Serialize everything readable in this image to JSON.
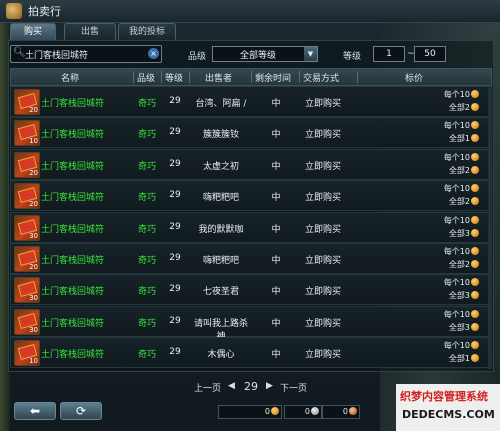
{
  "window": {
    "title": "拍卖行"
  },
  "tabs": [
    {
      "label": "购买",
      "active": true
    },
    {
      "label": "出售",
      "active": false
    },
    {
      "label": "我的投标",
      "active": false
    }
  ],
  "search": {
    "value": "土门客栈回城符",
    "clear_icon": "×"
  },
  "filters": {
    "grade_label": "品级",
    "grade_value": "全部等级",
    "level_label": "等级",
    "level_min": "1",
    "level_sep": "~",
    "level_max": "50"
  },
  "columns": [
    "名称",
    "品级",
    "等级",
    "出售者",
    "剩余时间",
    "交易方式",
    "标价"
  ],
  "rows": [
    {
      "name": "土门客栈回城符",
      "qty": "20",
      "grade": "奇巧",
      "level": "29",
      "seller": "台湾、阿扁 /",
      "time": "中",
      "mode": "立即购买",
      "unit_price": "每个10",
      "total_price": "全部2"
    },
    {
      "name": "土门客栈回城符",
      "qty": "10",
      "grade": "奇巧",
      "level": "29",
      "seller": "簇簇簇钕",
      "time": "中",
      "mode": "立即购买",
      "unit_price": "每个10",
      "total_price": "全部1"
    },
    {
      "name": "土门客栈回城符",
      "qty": "20",
      "grade": "奇巧",
      "level": "29",
      "seller": "太虚之初",
      "time": "中",
      "mode": "立即购买",
      "unit_price": "每个10",
      "total_price": "全部2"
    },
    {
      "name": "土门客栈回城符",
      "qty": "20",
      "grade": "奇巧",
      "level": "29",
      "seller": "嗨粑粑吧",
      "time": "中",
      "mode": "立即购买",
      "unit_price": "每个10",
      "total_price": "全部2"
    },
    {
      "name": "土门客栈回城符",
      "qty": "30",
      "grade": "奇巧",
      "level": "29",
      "seller": "我的默默咖",
      "time": "中",
      "mode": "立即购买",
      "unit_price": "每个10",
      "total_price": "全部3"
    },
    {
      "name": "土门客栈回城符",
      "qty": "20",
      "grade": "奇巧",
      "level": "29",
      "seller": "嗨粑粑吧",
      "time": "中",
      "mode": "立即购买",
      "unit_price": "每个10",
      "total_price": "全部2"
    },
    {
      "name": "土门客栈回城符",
      "qty": "30",
      "grade": "奇巧",
      "level": "29",
      "seller": "七夜圣君",
      "time": "中",
      "mode": "立即购买",
      "unit_price": "每个10",
      "total_price": "全部3"
    },
    {
      "name": "土门客栈回城符",
      "qty": "30",
      "grade": "奇巧",
      "level": "29",
      "seller": "请叫我上路杀神",
      "time": "中",
      "mode": "立即购买",
      "unit_price": "每个10",
      "total_price": "全部3"
    },
    {
      "name": "土门客栈回城符",
      "qty": "10",
      "grade": "奇巧",
      "level": "29",
      "seller": "木偶心",
      "time": "中",
      "mode": "立即购买",
      "unit_price": "每个10",
      "total_price": "全部1"
    }
  ],
  "pager": {
    "prev": "上一页",
    "page": "29",
    "next": "下一页"
  },
  "buttons": {
    "back_icon": "⬅",
    "refresh_icon": "⟳"
  },
  "wallet": {
    "gold": "0",
    "silver": "0",
    "bronze": "0"
  },
  "watermark": {
    "line1": "织梦内容管理系统",
    "line2": "DEDECMS.COM"
  }
}
